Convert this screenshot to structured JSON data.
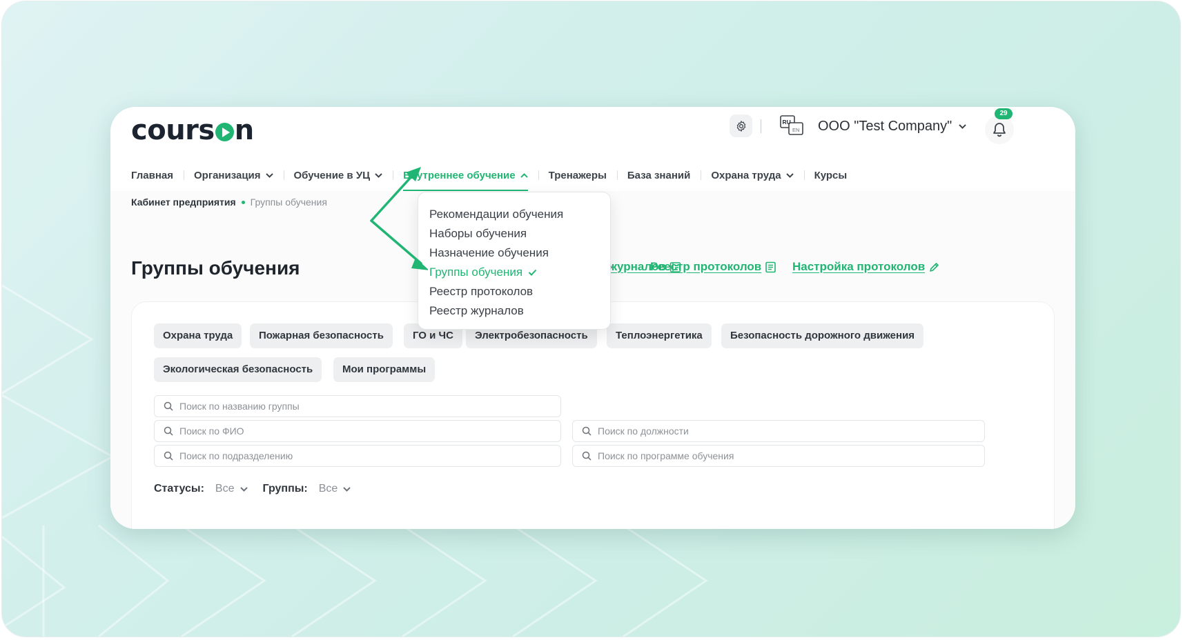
{
  "brand": {
    "logo_text_1": "cours",
    "logo_text_2": "n",
    "accent_color": "#21b573"
  },
  "header": {
    "lang": {
      "primary": "RU",
      "secondary": "EN"
    },
    "company": "ООО \"Test Company\"",
    "notifications_count": "29",
    "icons": [
      "gear-icon",
      "language-icon",
      "chevron-down-icon",
      "bell-icon"
    ]
  },
  "nav": {
    "items": [
      {
        "label": "Главная",
        "has_menu": false
      },
      {
        "label": "Организация",
        "has_menu": true
      },
      {
        "label": "Обучение в УЦ",
        "has_menu": true
      },
      {
        "label": "Внутреннее обучение",
        "has_menu": true,
        "active": true
      },
      {
        "label": "Тренажеры",
        "has_menu": false
      },
      {
        "label": "База знаний",
        "has_menu": false
      },
      {
        "label": "Охрана труда",
        "has_menu": true
      },
      {
        "label": "Курсы",
        "has_menu": false
      }
    ]
  },
  "dropdown": {
    "items": [
      {
        "label": "Рекомендации обучения"
      },
      {
        "label": "Наборы обучения"
      },
      {
        "label": "Назначение обучения"
      },
      {
        "label": "Группы обучения",
        "selected": true
      },
      {
        "label": "Реестр протоколов"
      },
      {
        "label": "Реестр журналов"
      }
    ]
  },
  "breadcrumb": {
    "parent": "Кабинет предприятия",
    "current": "Группы обучения"
  },
  "page": {
    "title": "Группы обучения",
    "links": {
      "journals": "журналов",
      "protocols": "Реестр протоколов",
      "protocol_settings": "Настройка протоколов"
    }
  },
  "categories": [
    "Охрана труда",
    "Пожарная безопасность",
    "ГО и ЧС",
    "Электробезопасность",
    "Теплоэнергетика",
    "Безопасность дорожного движения",
    "Экологическая безопасность",
    "Мои программы"
  ],
  "search": {
    "group_name": "Поиск по названию группы",
    "fio": "Поиск по ФИО",
    "position": "Поиск по должности",
    "department": "Поиск по подразделению",
    "program": "Поиск по программе обучения"
  },
  "filters": {
    "status_label": "Статусы:",
    "status_value": "Все",
    "groups_label": "Группы:",
    "groups_value": "Все"
  }
}
